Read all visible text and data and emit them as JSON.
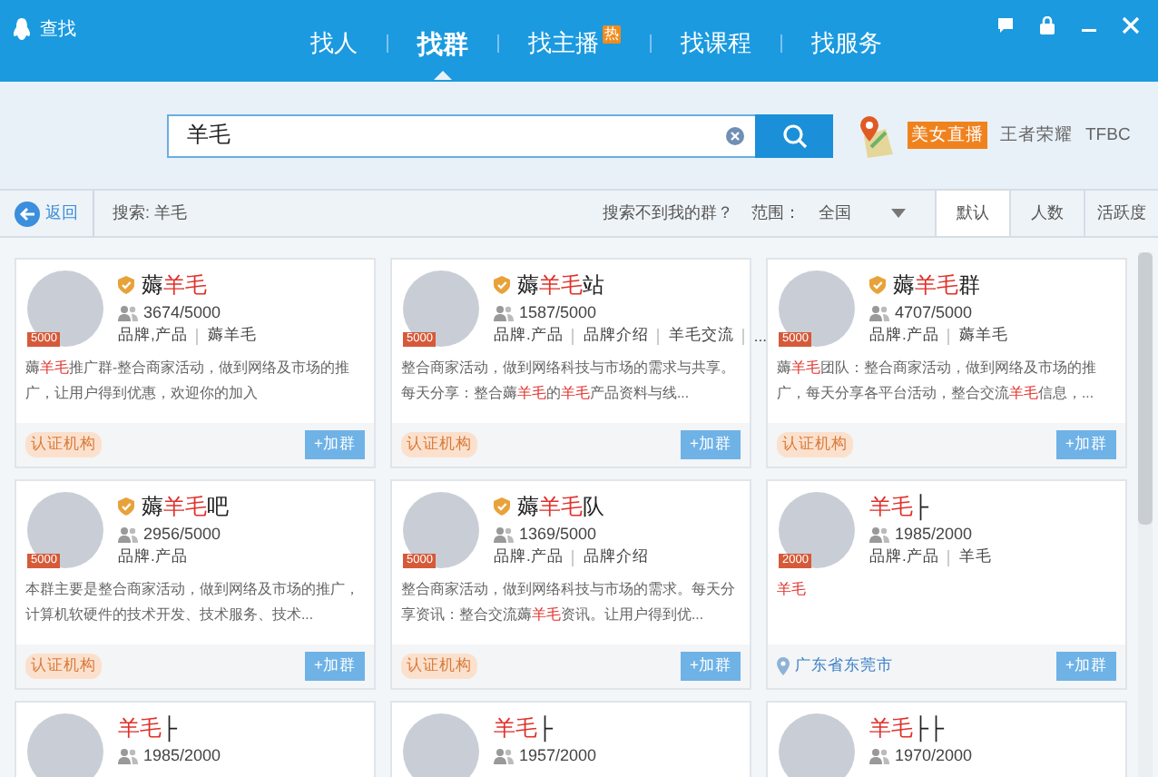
{
  "window": {
    "title": "查找"
  },
  "nav_tabs": [
    {
      "label": "找人",
      "selected": false
    },
    {
      "label": "找群",
      "selected": true
    },
    {
      "label": "找主播",
      "selected": false,
      "badge": "热"
    },
    {
      "label": "找课程",
      "selected": false
    },
    {
      "label": "找服务",
      "selected": false
    }
  ],
  "search": {
    "value": "羊毛"
  },
  "hot_links": [
    {
      "label": "美女直播",
      "kind": "tag"
    },
    {
      "label": "王者荣耀",
      "kind": "plain"
    },
    {
      "label": "TFBC",
      "kind": "plain"
    }
  ],
  "filter_bar": {
    "back": "返回",
    "query": "搜索: 羊毛",
    "help": "搜索不到我的群？",
    "scope_label": "范围：",
    "scope_value": "全国",
    "sort_tabs": [
      {
        "label": "默认",
        "selected": true
      },
      {
        "label": "人数",
        "selected": false
      },
      {
        "label": "活跃度",
        "selected": false
      }
    ]
  },
  "cards": [
    {
      "title": [
        {
          "text": "薅",
          "highlight": false
        },
        {
          "text": "羊毛",
          "highlight": true
        }
      ],
      "verified": true,
      "level": "5000",
      "members": "3674/5000",
      "tags": [
        "品牌,产品",
        "薅羊毛"
      ],
      "description": [
        {
          "text": "薅",
          "highlight": false
        },
        {
          "text": "羊毛",
          "highlight": true
        },
        {
          "text": "推广群-整合商家活动，做到网络及市场的推广，让用户得到优惠，欢迎你的加入",
          "highlight": false
        }
      ],
      "footer": {
        "kind": "badge",
        "text": "认证机构"
      },
      "join": "+加群"
    },
    {
      "title": [
        {
          "text": "薅",
          "highlight": false
        },
        {
          "text": "羊毛",
          "highlight": true
        },
        {
          "text": "站",
          "highlight": false
        }
      ],
      "verified": true,
      "level": "5000",
      "members": "1587/5000",
      "tags": [
        "品牌.产品",
        "品牌介绍",
        "羊毛交流",
        "..."
      ],
      "description": [
        {
          "text": "整合商家活动，做到网络科技与市场的需求与共享。每天分享：整合薅",
          "highlight": false
        },
        {
          "text": "羊毛",
          "highlight": true
        },
        {
          "text": "的",
          "highlight": false
        },
        {
          "text": "羊毛",
          "highlight": true
        },
        {
          "text": "产品资料与线...",
          "highlight": false
        }
      ],
      "footer": {
        "kind": "badge",
        "text": "认证机构"
      },
      "join": "+加群"
    },
    {
      "title": [
        {
          "text": "薅",
          "highlight": false
        },
        {
          "text": "羊毛",
          "highlight": true
        },
        {
          "text": "群",
          "highlight": false
        }
      ],
      "verified": true,
      "level": "5000",
      "members": "4707/5000",
      "tags": [
        "品牌.产品",
        "薅羊毛"
      ],
      "description": [
        {
          "text": "薅",
          "highlight": false
        },
        {
          "text": "羊毛",
          "highlight": true
        },
        {
          "text": "团队：整合商家活动，做到网络及市场的推广，每天分享各平台活动，整合交流",
          "highlight": false
        },
        {
          "text": "羊毛",
          "highlight": true
        },
        {
          "text": "信息，...",
          "highlight": false
        }
      ],
      "footer": {
        "kind": "badge",
        "text": "认证机构"
      },
      "join": "+加群"
    },
    {
      "title": [
        {
          "text": "薅",
          "highlight": false
        },
        {
          "text": "羊毛",
          "highlight": true
        },
        {
          "text": "吧",
          "highlight": false
        }
      ],
      "verified": true,
      "level": "5000",
      "members": "2956/5000",
      "tags": [
        "品牌.产品"
      ],
      "description": [
        {
          "text": "本群主要是整合商家活动，做到网络及市场的推广，计算机软硬件的技术开发、技术服务、技术...",
          "highlight": false
        }
      ],
      "footer": {
        "kind": "badge",
        "text": "认证机构"
      },
      "join": "+加群"
    },
    {
      "title": [
        {
          "text": "薅",
          "highlight": false
        },
        {
          "text": "羊毛",
          "highlight": true
        },
        {
          "text": "队",
          "highlight": false
        }
      ],
      "verified": true,
      "level": "5000",
      "members": "1369/5000",
      "tags": [
        "品牌.产品",
        "品牌介绍"
      ],
      "description": [
        {
          "text": "整合商家活动，做到网络科技与市场的需求。每天分享资讯：整合交流薅",
          "highlight": false
        },
        {
          "text": "羊毛",
          "highlight": true
        },
        {
          "text": "资讯。让用户得到优...",
          "highlight": false
        }
      ],
      "footer": {
        "kind": "badge",
        "text": "认证机构"
      },
      "join": "+加群"
    },
    {
      "title": [
        {
          "text": "羊毛",
          "highlight": true
        },
        {
          "text": "├",
          "highlight": false
        }
      ],
      "verified": false,
      "level": "2000",
      "members": "1985/2000",
      "tags": [
        "品牌.产品",
        "羊毛"
      ],
      "description": [
        {
          "text": "羊毛",
          "highlight": true
        }
      ],
      "footer": {
        "kind": "location",
        "text": "广东省东莞市"
      },
      "join": "+加群"
    },
    {
      "title": [
        {
          "text": "羊毛",
          "highlight": true
        },
        {
          "text": "├",
          "highlight": false
        }
      ],
      "verified": false,
      "members": "1985/2000"
    },
    {
      "title": [
        {
          "text": "羊毛",
          "highlight": true
        },
        {
          "text": "├",
          "highlight": false
        }
      ],
      "verified": false,
      "members": "1957/2000"
    },
    {
      "title": [
        {
          "text": "羊毛",
          "highlight": true
        },
        {
          "text": "├├",
          "highlight": false
        }
      ],
      "verified": false,
      "members": "1970/2000"
    }
  ]
}
